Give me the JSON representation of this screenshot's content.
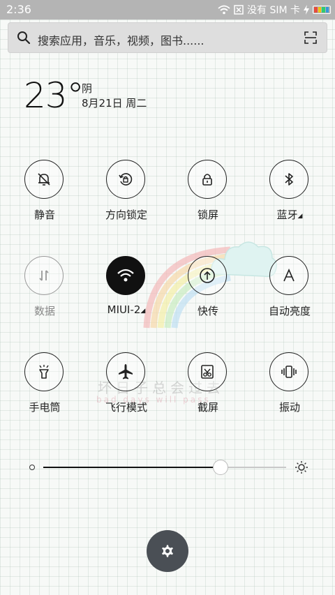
{
  "status": {
    "time": "2:36",
    "carrier": "没有 SIM 卡",
    "battery_colors": [
      "#e74c3c",
      "#f1c40f",
      "#2ecc71",
      "#3498db"
    ]
  },
  "search": {
    "placeholder": "搜索应用，音乐，视频，图书......",
    "icon": "search-icon",
    "scan_icon": "scan-icon"
  },
  "weather": {
    "temperature": "23°",
    "condition": "阴",
    "date": "8月21日 周二"
  },
  "toggles": [
    {
      "label": "静音",
      "icon": "bell-off-icon",
      "state": "off"
    },
    {
      "label": "方向锁定",
      "icon": "rotation-lock-icon",
      "state": "off"
    },
    {
      "label": "锁屏",
      "icon": "lock-icon",
      "state": "off"
    },
    {
      "label": "蓝牙",
      "icon": "bluetooth-icon",
      "state": "off",
      "has_more": true
    },
    {
      "label": "数据",
      "icon": "mobile-data-icon",
      "state": "disabled"
    },
    {
      "label": "MIUI-2",
      "icon": "wifi-icon",
      "state": "on",
      "has_more": true
    },
    {
      "label": "快传",
      "icon": "transfer-icon",
      "state": "off"
    },
    {
      "label": "自动亮度",
      "icon": "auto-brightness-icon",
      "state": "off"
    },
    {
      "label": "手电筒",
      "icon": "flashlight-icon",
      "state": "off"
    },
    {
      "label": "飞行模式",
      "icon": "airplane-icon",
      "state": "off"
    },
    {
      "label": "截屏",
      "icon": "screenshot-icon",
      "state": "off"
    },
    {
      "label": "振动",
      "icon": "vibrate-icon",
      "state": "off"
    }
  ],
  "brightness": {
    "level": 0.73
  },
  "wallpaper": {
    "text_cn": "坏日子总会过去",
    "text_en": "bad days will pass"
  },
  "settings": {
    "icon": "gear-icon"
  }
}
